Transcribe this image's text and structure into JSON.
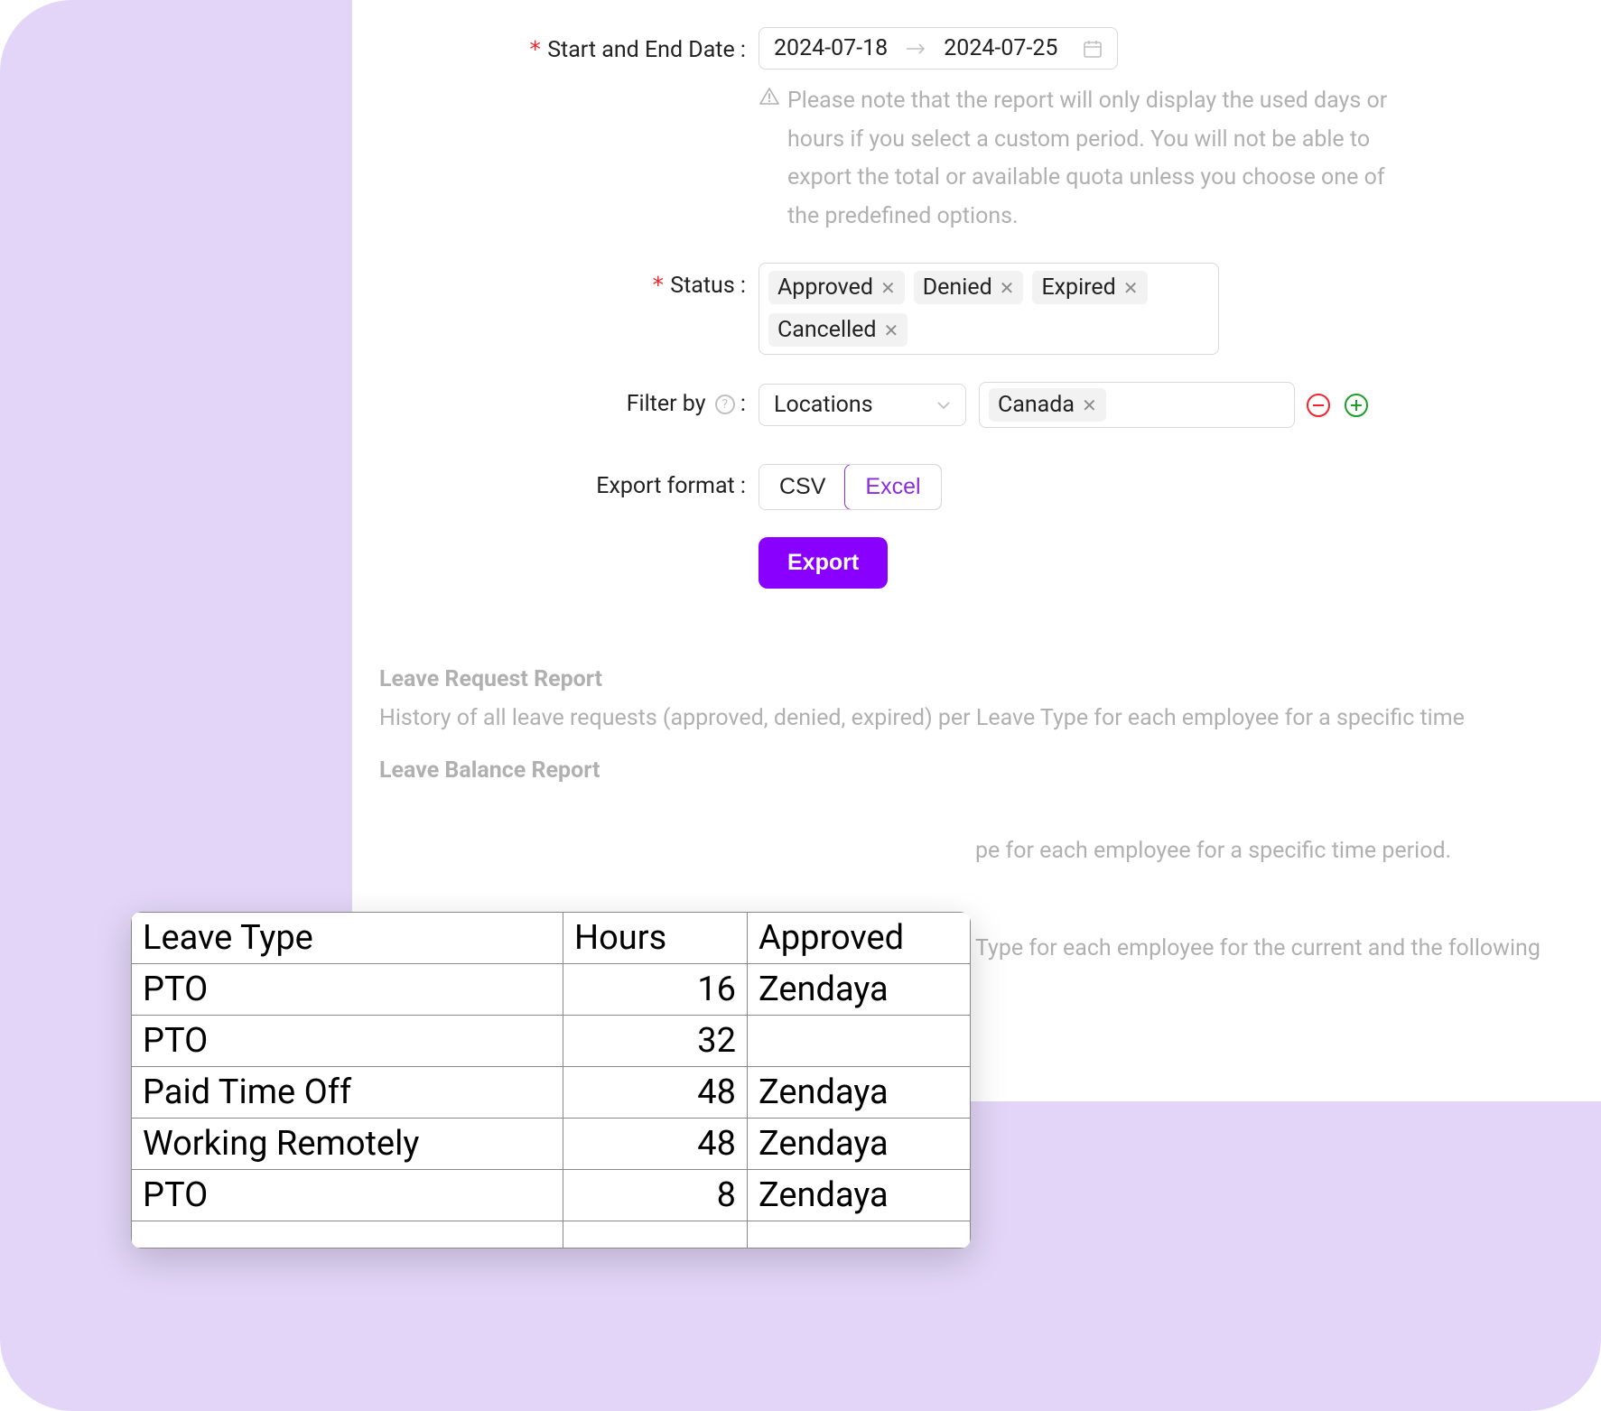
{
  "form": {
    "dateLabel": "Start and End Date",
    "startDate": "2024-07-18",
    "endDate": "2024-07-25",
    "dateHint": "Please note that the report will only display the used days or hours if you select a custom period. You will not be able to export the total or available quota unless you choose one of the predefined options.",
    "statusLabel": "Status",
    "statusTags": [
      "Approved",
      "Denied",
      "Expired",
      "Cancelled"
    ],
    "filterByLabel": "Filter by",
    "filterSelect": "Locations",
    "filterTags": [
      "Canada"
    ],
    "exportFormatLabel": "Export format",
    "formatCSV": "CSV",
    "formatExcel": "Excel",
    "exportButton": "Export"
  },
  "reports": {
    "r1Title": "Leave Request Report",
    "r1Desc": "History of all leave requests (approved, denied, expired) per Leave Type for each employee for a specific time",
    "r2Title": "Leave Balance Report",
    "r2Frag": "pe for each employee for a specific time period.",
    "r3Frag": "Type for each employee for the current and the following"
  },
  "table": {
    "headers": {
      "c1": "Leave Type",
      "c2": "Hours",
      "c3": "Approved"
    },
    "rows": [
      {
        "c1": "PTO",
        "c2": "16",
        "c3": "Zendaya"
      },
      {
        "c1": "PTO",
        "c2": "32",
        "c3": ""
      },
      {
        "c1": "Paid Time Off",
        "c2": "48",
        "c3": "Zendaya"
      },
      {
        "c1": "Working Remotely",
        "c2": "48",
        "c3": "Zendaya"
      },
      {
        "c1": "PTO",
        "c2": "8",
        "c3": "Zendaya"
      }
    ]
  }
}
